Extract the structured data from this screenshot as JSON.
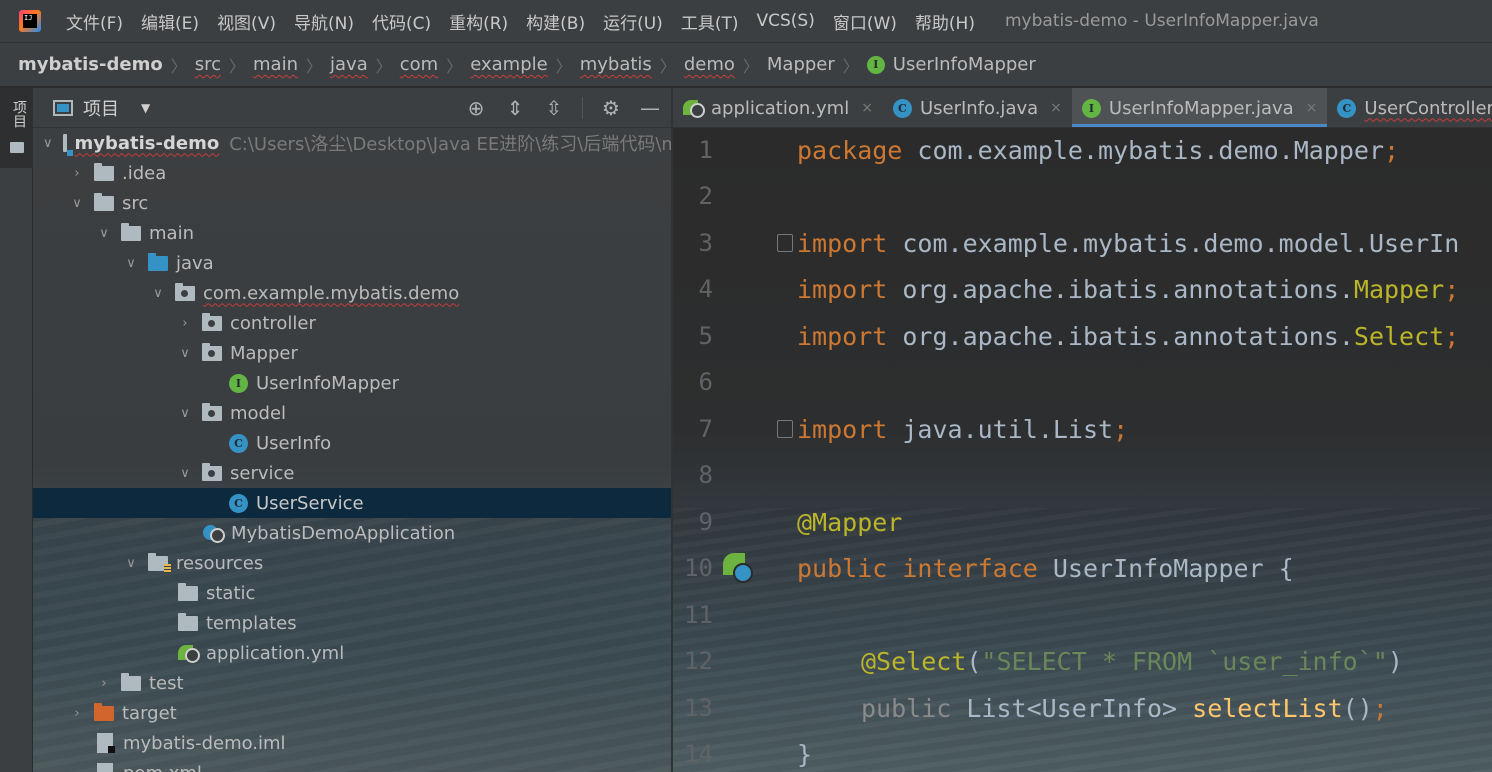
{
  "menubar": {
    "logo": "IJ",
    "items": [
      "文件(F)",
      "编辑(E)",
      "视图(V)",
      "导航(N)",
      "代码(C)",
      "重构(R)",
      "构建(B)",
      "运行(U)",
      "工具(T)",
      "VCS(S)",
      "窗口(W)",
      "帮助(H)"
    ],
    "window_title": "mybatis-demo - UserInfoMapper.java"
  },
  "breadcrumb": {
    "items": [
      "mybatis-demo",
      "src",
      "main",
      "java",
      "com",
      "example",
      "mybatis",
      "demo",
      "Mapper",
      "UserInfoMapper"
    ],
    "separator": "〉"
  },
  "left_strip": {
    "label": "项目"
  },
  "project": {
    "title": "项目",
    "tree": [
      {
        "label": "mybatis-demo",
        "hint": "C:\\Users\\洛尘\\Desktop\\Java EE进阶\\练习\\后端代码\\m"
      },
      {
        "label": ".idea"
      },
      {
        "label": "src"
      },
      {
        "label": "main"
      },
      {
        "label": "java"
      },
      {
        "label": "com.example.mybatis.demo"
      },
      {
        "label": "controller"
      },
      {
        "label": "Mapper"
      },
      {
        "label": "UserInfoMapper"
      },
      {
        "label": "model"
      },
      {
        "label": "UserInfo"
      },
      {
        "label": "service"
      },
      {
        "label": "UserService"
      },
      {
        "label": "MybatisDemoApplication"
      },
      {
        "label": "resources"
      },
      {
        "label": "static"
      },
      {
        "label": "templates"
      },
      {
        "label": "application.yml"
      },
      {
        "label": "test"
      },
      {
        "label": "target"
      },
      {
        "label": "mybatis-demo.iml"
      },
      {
        "label": "pom.xml"
      }
    ]
  },
  "tabs": [
    {
      "label": "application.yml",
      "close": "×"
    },
    {
      "label": "UserInfo.java",
      "close": "×"
    },
    {
      "label": "UserInfoMapper.java",
      "close": "×"
    },
    {
      "label": "UserController.j"
    }
  ],
  "editor": {
    "line_numbers": [
      "1",
      "2",
      "3",
      "4",
      "5",
      "6",
      "7",
      "8",
      "9",
      "10",
      "11",
      "12",
      "13",
      "14"
    ],
    "lines": {
      "l1_kw": "package",
      "l1_rest": " com.example.mybatis.demo.Mapper",
      "l1_semi": ";",
      "l3_kw": "import",
      "l3_rest": " com.example.mybatis.demo.model.UserIn",
      "l4_kw": "import",
      "l4_rest": " org.apache.ibatis.annotations.",
      "l4_ann": "Mapper",
      "l4_semi": ";",
      "l5_kw": "import",
      "l5_rest": " org.apache.ibatis.annotations.",
      "l5_ann": "Select",
      "l5_semi": ";",
      "l7_kw": "import",
      "l7_rest": " java.util.List",
      "l7_semi": ";",
      "l9_ann": "@Mapper",
      "l10_kw": "public interface",
      "l10_rest": " UserInfoMapper {",
      "l12_ann": "@Select",
      "l12_open": "(",
      "l12_str": "\"SELECT * FROM `user_info`\"",
      "l12_close": ")",
      "l13_kw": "public",
      "l13_rest": " List<UserInfo> ",
      "l13_fn": "selectList",
      "l13_paren": "()",
      "l13_semi": ";",
      "l14": "}"
    }
  },
  "colors": {
    "keyword": "#cc7832",
    "annotation": "#bbb529",
    "string": "#6a8759",
    "function": "#ffc66d",
    "accent": "#4a88c7"
  }
}
